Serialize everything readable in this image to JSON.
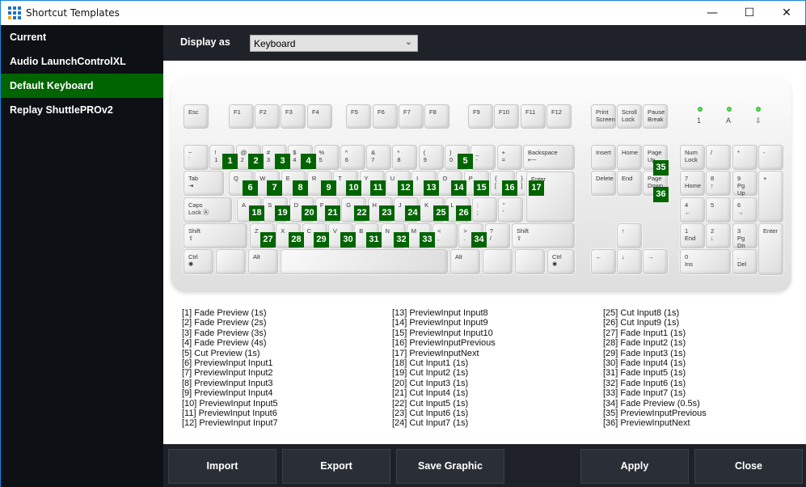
{
  "window": {
    "title": "Shortcut Templates",
    "minimize": "—",
    "maximize": "☐",
    "close": "✕"
  },
  "sidebar": {
    "items": [
      {
        "label": "Current"
      },
      {
        "label": "Audio LaunchControlXL"
      },
      {
        "label": "Default Keyboard",
        "selected": true
      },
      {
        "label": "Replay ShuttlePROv2"
      }
    ]
  },
  "header": {
    "display_label": "Display as",
    "display_value": "Keyboard"
  },
  "colors": {
    "accent": "#006400",
    "sidebar_bg": "#0d1015",
    "header_bg": "#1f2329"
  },
  "keyboard": {
    "keys": [
      {
        "t": "Esc"
      },
      {
        "t": "F1"
      },
      {
        "t": "F2"
      },
      {
        "t": "F3"
      },
      {
        "t": "F4"
      },
      {
        "t": "F5"
      },
      {
        "t": "F6"
      },
      {
        "t": "F7"
      },
      {
        "t": "F8"
      },
      {
        "t": "F9"
      },
      {
        "t": "F10"
      },
      {
        "t": "F11"
      },
      {
        "t": "F12"
      },
      {
        "t": "Print",
        "b": "Screen"
      },
      {
        "t": "Scroll",
        "b": "Lock"
      },
      {
        "t": "Pause",
        "b": "Break"
      },
      {
        "t": "~",
        "b": "`"
      },
      {
        "t": "!",
        "b": "1"
      },
      {
        "t": "@",
        "b": "2"
      },
      {
        "t": "#",
        "b": "3"
      },
      {
        "t": "$",
        "b": "4"
      },
      {
        "t": "%",
        "b": "5"
      },
      {
        "t": "^",
        "b": "6"
      },
      {
        "t": "&",
        "b": "7"
      },
      {
        "t": "*",
        "b": "8"
      },
      {
        "t": "(",
        "b": "9"
      },
      {
        "t": ")",
        "b": "0"
      },
      {
        "t": "_",
        "b": "-"
      },
      {
        "t": "+",
        "b": "="
      },
      {
        "t": "Backspace",
        "b": "⟵"
      },
      {
        "t": "Tab",
        "b": "⇥"
      },
      {
        "t": "Q"
      },
      {
        "t": "W"
      },
      {
        "t": "E"
      },
      {
        "t": "R"
      },
      {
        "t": "T"
      },
      {
        "t": "Y"
      },
      {
        "t": "U"
      },
      {
        "t": "I"
      },
      {
        "t": "O"
      },
      {
        "t": "P"
      },
      {
        "t": "{",
        "b": "["
      },
      {
        "t": "}",
        "b": "]"
      },
      {
        "t": "Caps",
        "b": "Lock Ⓐ"
      },
      {
        "t": "A"
      },
      {
        "t": "S"
      },
      {
        "t": "D"
      },
      {
        "t": "F"
      },
      {
        "t": "G"
      },
      {
        "t": "H"
      },
      {
        "t": "J"
      },
      {
        "t": "K"
      },
      {
        "t": "L"
      },
      {
        "t": ":",
        "b": ";"
      },
      {
        "t": "\"",
        "b": "'"
      },
      {
        "t": "Enter",
        "b": "↵"
      },
      {
        "t": "Shift",
        "b": "⇧"
      },
      {
        "t": "Z"
      },
      {
        "t": "X"
      },
      {
        "t": "C"
      },
      {
        "t": "V"
      },
      {
        "t": "B"
      },
      {
        "t": "N"
      },
      {
        "t": "M"
      },
      {
        "t": "<",
        "b": ","
      },
      {
        "t": ">",
        "b": "."
      },
      {
        "t": "?",
        "b": "/"
      },
      {
        "t": "Shift",
        "b": "⇧"
      },
      {
        "t": "Ctrl",
        "b": "✱"
      },
      {
        "t": ""
      },
      {
        "t": "Alt"
      },
      {
        "t": ""
      },
      {
        "t": "Alt"
      },
      {
        "t": ""
      },
      {
        "t": ""
      },
      {
        "t": "Ctrl",
        "b": "✱"
      },
      {
        "t": "Insert"
      },
      {
        "t": "Home"
      },
      {
        "t": "Page",
        "b": "Up"
      },
      {
        "t": "Delete"
      },
      {
        "t": "End"
      },
      {
        "t": "Page",
        "b": "Down"
      },
      {
        "t": "↑"
      },
      {
        "t": "←"
      },
      {
        "t": "↓"
      },
      {
        "t": "→"
      },
      {
        "t": "Num",
        "b": "Lock"
      },
      {
        "t": "/"
      },
      {
        "t": "*"
      },
      {
        "t": "-"
      },
      {
        "t": "7",
        "b": "Home"
      },
      {
        "t": "8",
        "b": "↑"
      },
      {
        "t": "9",
        "b": "Pg Up"
      },
      {
        "t": "+"
      },
      {
        "t": "4",
        "b": "←"
      },
      {
        "t": "5"
      },
      {
        "t": "6",
        "b": "→"
      },
      {
        "t": "1",
        "b": "End"
      },
      {
        "t": "2",
        "b": "↓"
      },
      {
        "t": "3",
        "b": "Pg Dn"
      },
      {
        "t": "Enter"
      },
      {
        "t": "0",
        "b": "Ins"
      },
      {
        "t": ".",
        "b": "Del"
      }
    ],
    "indicators": [
      "1",
      "A",
      "⇩"
    ],
    "badges": [
      "1",
      "2",
      "3",
      "4",
      "5",
      "6",
      "7",
      "8",
      "9",
      "10",
      "11",
      "12",
      "13",
      "14",
      "15",
      "16",
      "17",
      "18",
      "19",
      "20",
      "21",
      "22",
      "23",
      "24",
      "25",
      "26",
      "27",
      "28",
      "29",
      "30",
      "31",
      "32",
      "33",
      "34",
      "35",
      "36"
    ]
  },
  "legend": [
    [
      "[1] Fade Preview (1s)",
      "[2] Fade Preview (2s)",
      "[3] Fade Preview (3s)",
      "[4] Fade Preview (4s)",
      "[5] Cut Preview (1s)",
      "[6] PreviewInput Input1",
      "[7] PreviewInput Input2",
      "[8] PreviewInput Input3",
      "[9] PreviewInput Input4",
      "[10] PreviewInput Input5",
      "[11] PreviewInput Input6",
      "[12] PreviewInput Input7"
    ],
    [
      "[13] PreviewInput Input8",
      "[14] PreviewInput Input9",
      "[15] PreviewInput Input10",
      "[16] PreviewInputPrevious",
      "[17] PreviewInputNext",
      "[18] Cut Input1 (1s)",
      "[19] Cut Input2 (1s)",
      "[20] Cut Input3 (1s)",
      "[21] Cut Input4 (1s)",
      "[22] Cut Input5 (1s)",
      "[23] Cut Input6 (1s)",
      "[24] Cut Input7 (1s)"
    ],
    [
      "[25] Cut Input8 (1s)",
      "[26] Cut Input9 (1s)",
      "[27] Fade Input1 (1s)",
      "[28] Fade Input2 (1s)",
      "[29] Fade Input3 (1s)",
      "[30] Fade Input4 (1s)",
      "[31] Fade Input5 (1s)",
      "[32] Fade Input6 (1s)",
      "[33] Fade Input7 (1s)",
      "[34] Fade Preview (0.5s)",
      "[35] PreviewInputPrevious",
      "[36] PreviewInputNext"
    ]
  ],
  "footer": {
    "import": "Import",
    "export": "Export",
    "save_graphic": "Save Graphic",
    "apply": "Apply",
    "close": "Close"
  }
}
